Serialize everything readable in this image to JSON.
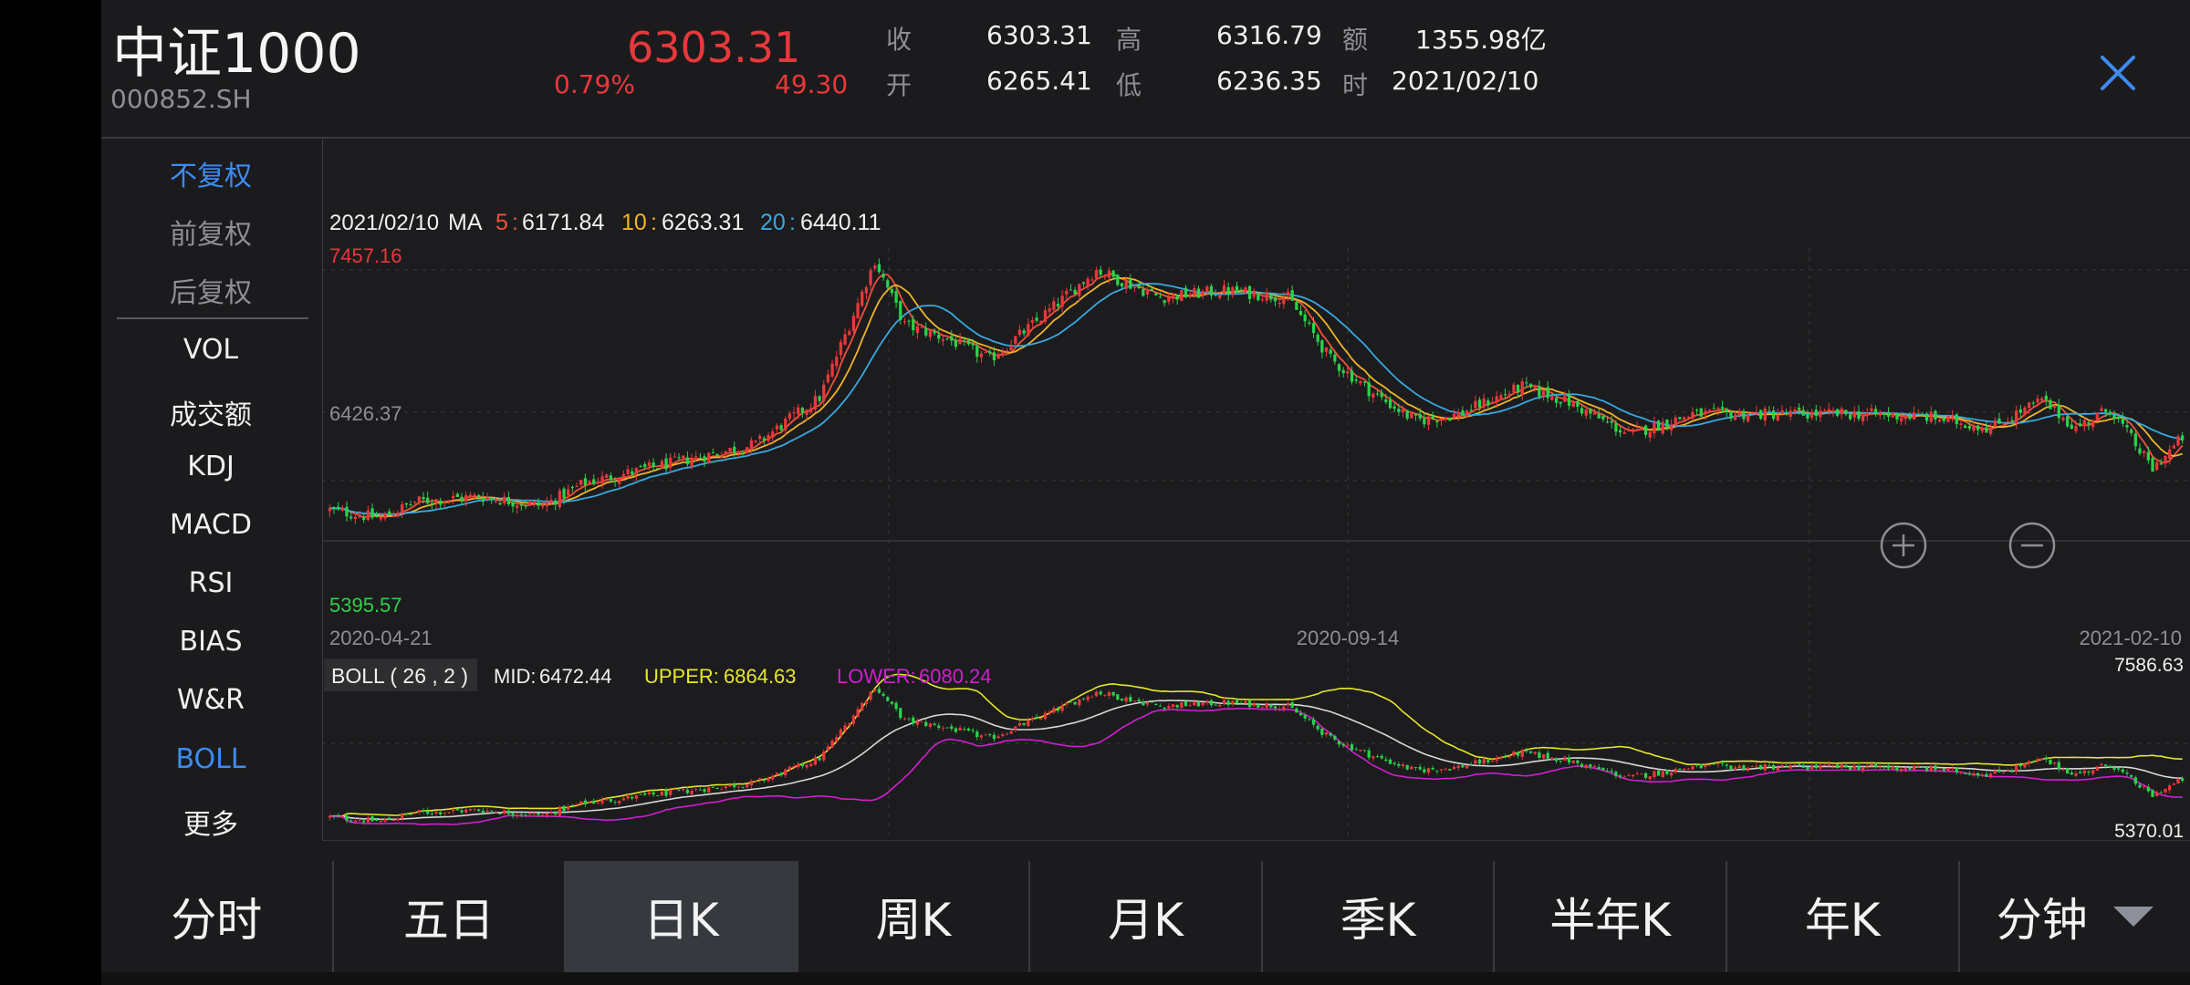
{
  "header": {
    "name": "中证1000",
    "code": "000852.SH",
    "price": "6303.31",
    "change_pct": "0.79%",
    "change": "49.30",
    "fields": [
      {
        "label": "收",
        "value": "6303.31"
      },
      {
        "label": "开",
        "value": "6265.41"
      },
      {
        "label": "高",
        "value": "6316.79"
      },
      {
        "label": "低",
        "value": "6236.35"
      },
      {
        "label": "额",
        "value": "1355.98亿"
      },
      {
        "label": "时",
        "value": "2021/02/10"
      }
    ]
  },
  "sidebar": {
    "items": [
      {
        "label": "不复权",
        "state": "active"
      },
      {
        "label": "前复权",
        "state": "muted"
      },
      {
        "label": "后复权",
        "state": "muted"
      },
      {
        "label": "VOL",
        "state": ""
      },
      {
        "label": "成交额",
        "state": ""
      },
      {
        "label": "KDJ",
        "state": ""
      },
      {
        "label": "MACD",
        "state": ""
      },
      {
        "label": "RSI",
        "state": ""
      },
      {
        "label": "BIAS",
        "state": ""
      },
      {
        "label": "W&R",
        "state": ""
      },
      {
        "label": "BOLL",
        "state": "active"
      },
      {
        "label": "更多",
        "state": ""
      }
    ]
  },
  "tabs": [
    {
      "label": "分时",
      "active": false
    },
    {
      "label": "五日",
      "active": false
    },
    {
      "label": "日K",
      "active": true
    },
    {
      "label": "周K",
      "active": false
    },
    {
      "label": "月K",
      "active": false
    },
    {
      "label": "季K",
      "active": false
    },
    {
      "label": "半年K",
      "active": false
    },
    {
      "label": "年K",
      "active": false
    },
    {
      "label": "分钟",
      "active": false,
      "dropdown": true
    }
  ],
  "colors": {
    "up": "#e8383c",
    "down": "#2bd24a",
    "ma5": "#f0513a",
    "ma10": "#f0b429",
    "ma20": "#38a8e0",
    "boll_mid": "#d8d8d8",
    "boll_upper": "#e6e62a",
    "boll_lower": "#d21ed2",
    "accent": "#3d8bf0",
    "grid": "#3a3a3e"
  },
  "chart_data": {
    "type": "candlestick",
    "legend": {
      "date": "2021/02/10",
      "ma_label": "MA",
      "ma": [
        {
          "period": "5",
          "sep": ":",
          "value": "6171.84"
        },
        {
          "period": "10",
          "sep": ":",
          "value": "6263.31"
        },
        {
          "period": "20",
          "sep": ":",
          "value": "6440.11"
        }
      ]
    },
    "y_labels": {
      "max": "7457.16",
      "mid": "6426.37",
      "min": "5395.57"
    },
    "ylim": [
      5395.57,
      7457.16
    ],
    "x_labels": [
      "2020-04-21",
      "2020-09-14",
      "2021-02-10"
    ],
    "anchors": [
      [
        0,
        5600
      ],
      [
        12,
        5540
      ],
      [
        20,
        5660
      ],
      [
        35,
        5700
      ],
      [
        50,
        5630
      ],
      [
        60,
        5800
      ],
      [
        80,
        5940
      ],
      [
        100,
        6080
      ],
      [
        115,
        6420
      ],
      [
        122,
        6950
      ],
      [
        128,
        7420
      ],
      [
        135,
        6950
      ],
      [
        145,
        6850
      ],
      [
        155,
        6700
      ],
      [
        165,
        6950
      ],
      [
        180,
        7350
      ],
      [
        195,
        7150
      ],
      [
        210,
        7200
      ],
      [
        225,
        7150
      ],
      [
        235,
        6700
      ],
      [
        245,
        6450
      ],
      [
        255,
        6250
      ],
      [
        265,
        6300
      ],
      [
        280,
        6500
      ],
      [
        290,
        6400
      ],
      [
        305,
        6150
      ],
      [
        320,
        6300
      ],
      [
        340,
        6300
      ],
      [
        360,
        6300
      ],
      [
        375,
        6280
      ],
      [
        390,
        6200
      ],
      [
        402,
        6400
      ],
      [
        410,
        6200
      ],
      [
        418,
        6340
      ],
      [
        428,
        5900
      ],
      [
        435,
        6130
      ]
    ],
    "count": 436,
    "seed": 12345,
    "boll": {
      "label": "BOLL ( 26 , 2 )",
      "mid_label": "MID:",
      "mid": "6472.44",
      "upper_label": "UPPER:",
      "upper": "6864.63",
      "lower_label": "LOWER:",
      "lower": "6080.24",
      "ymax": "7586.63",
      "ymin": "5370.01",
      "ylim": [
        5370.01,
        7586.63
      ],
      "period": 26,
      "k": 2
    }
  },
  "zoom": {
    "in_icon": "zoom-in-icon",
    "out_icon": "zoom-out-icon"
  }
}
